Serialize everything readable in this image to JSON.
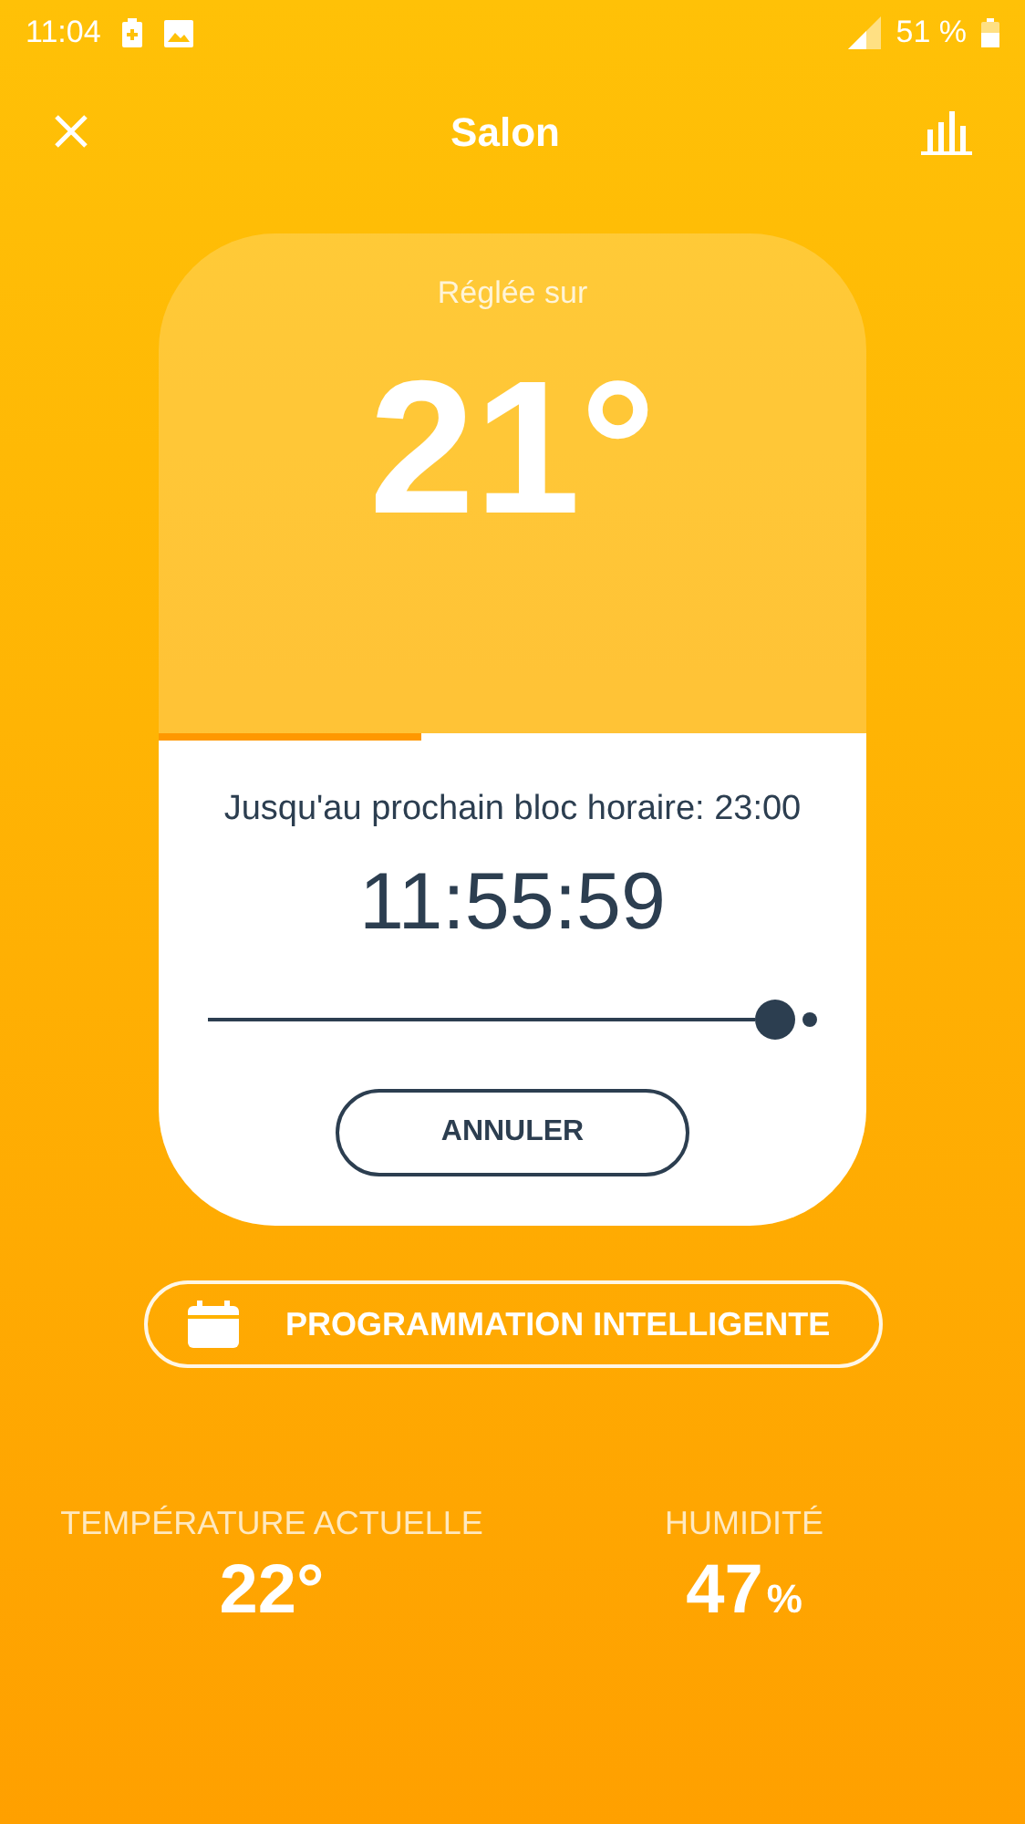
{
  "status_bar": {
    "time": "11:04",
    "battery": "51 %"
  },
  "header": {
    "title": "Salon"
  },
  "setpoint": {
    "label": "Réglée sur",
    "value": "21°",
    "progress": {
      "level": 0.37
    }
  },
  "timer": {
    "caption": "Jusqu'au prochain bloc horaire: 23:00",
    "remaining": "11:55:59",
    "slider": {
      "level": 0.93
    },
    "cancel_button": "ANNULER"
  },
  "schedule_button": "PROGRAMMATION INTELLIGENTE",
  "readings": [
    {
      "label": "TEMPÉRATURE ACTUELLE",
      "value": "22°"
    },
    {
      "label": "HUMIDITÉ",
      "value": "47",
      "unit": "%"
    }
  ]
}
